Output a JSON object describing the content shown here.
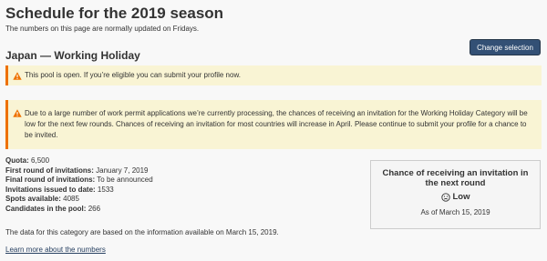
{
  "header": {
    "title": "Schedule for the 2019 season",
    "subtitle": "The numbers on this page are normally updated on Fridays."
  },
  "pool": {
    "title": "Japan — Working Holiday",
    "change_button": "Change selection"
  },
  "alerts": [
    {
      "icon": "warning-icon",
      "text": "This pool is open. If you’re eligible you can submit your profile now."
    },
    {
      "icon": "warning-icon",
      "text": "Due to a large number of work permit applications we’re currently processing, the chances of receiving an invitation for the Working Holiday Category will be low for the next few rounds. Chances of receiving an invitation for most countries will increase in April. Please continue to submit your profile for a chance to be invited."
    }
  ],
  "stats": [
    {
      "label": "Quota:",
      "value": "6,500"
    },
    {
      "label": "First round of invitations:",
      "value": "January 7, 2019"
    },
    {
      "label": "Final round of invitations:",
      "value": "To be announced"
    },
    {
      "label": "Invitations issued to date:",
      "value": "1533"
    },
    {
      "label": "Spots available:",
      "value": "4085"
    },
    {
      "label": "Candidates in the pool:",
      "value": "266"
    }
  ],
  "chance": {
    "title": "Chance of receiving an invitation in the next round",
    "icon": "sad-face-icon",
    "level": "Low",
    "as_of": "As of March 15, 2019"
  },
  "footer": {
    "data_note": "The data for this category are based on the information available on March 15, 2019.",
    "learn_more": "Learn more about the numbers"
  },
  "colors": {
    "button_bg": "#335075",
    "alert_bg": "#f9f4d4",
    "alert_border": "#ee7100",
    "link": "#284162"
  }
}
